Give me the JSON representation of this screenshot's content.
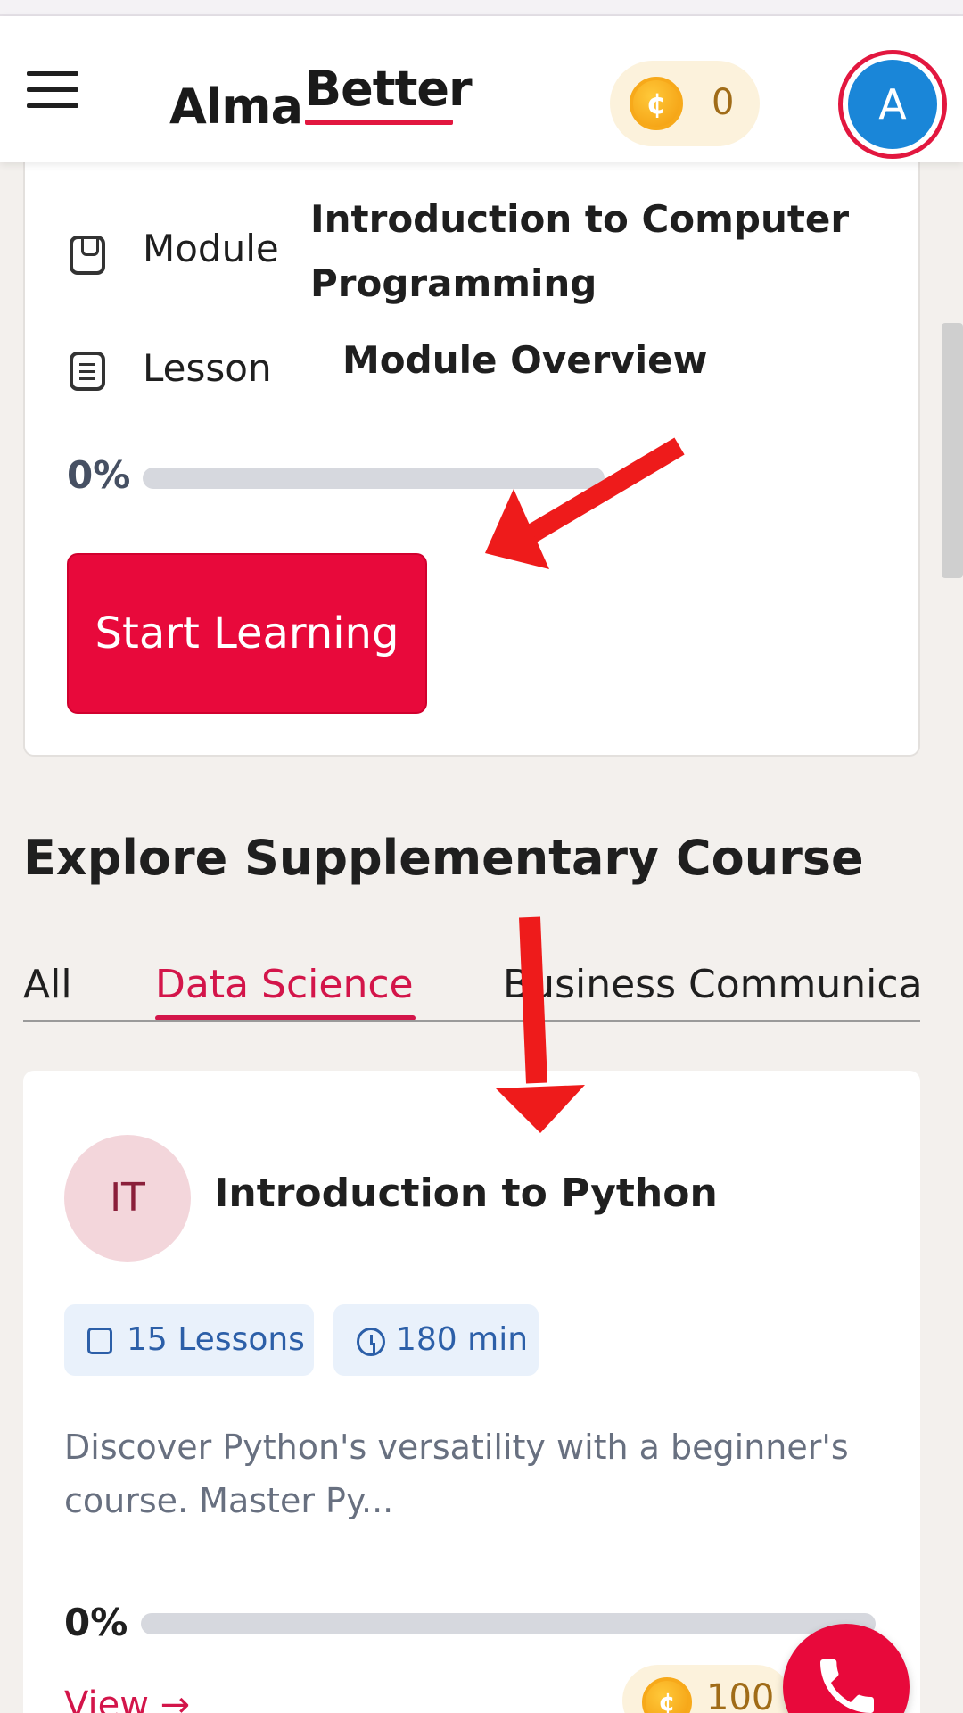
{
  "header": {
    "brand_part1": "Alma",
    "brand_part2": "Better",
    "coins": "0",
    "avatar_initial": "A"
  },
  "current_course": {
    "module_label": "Module",
    "module_value": "Introduction to Computer Programming",
    "lesson_label": "Lesson",
    "lesson_value": "Module Overview",
    "progress_text": "0%",
    "progress_fraction": 0,
    "start_button": "Start Learning"
  },
  "explore": {
    "title": "Explore Supplementary Course",
    "tabs": [
      {
        "label": "All",
        "active": false
      },
      {
        "label": "Data Science",
        "active": true
      },
      {
        "label": "Business Communica",
        "active": false
      }
    ]
  },
  "course_card": {
    "initials": "IT",
    "title": "Introduction to Python",
    "lessons_chip": "15 Lessons",
    "duration_chip": "180 min",
    "description": "Discover Python's versatility with a beginner's course. Master Py...",
    "progress_text": "0%",
    "progress_fraction": 0,
    "view_link": "View →",
    "reward_coins": "100"
  },
  "colors": {
    "brand_red": "#e8093b",
    "accent_pink": "#d3154a",
    "avatar_blue": "#1a86d8",
    "coin_gold": "#f7a91a"
  },
  "icons": [
    "menu-icon",
    "coin-icon",
    "module-icon",
    "lesson-icon",
    "lessons-icon",
    "clock-icon",
    "phone-icon"
  ]
}
